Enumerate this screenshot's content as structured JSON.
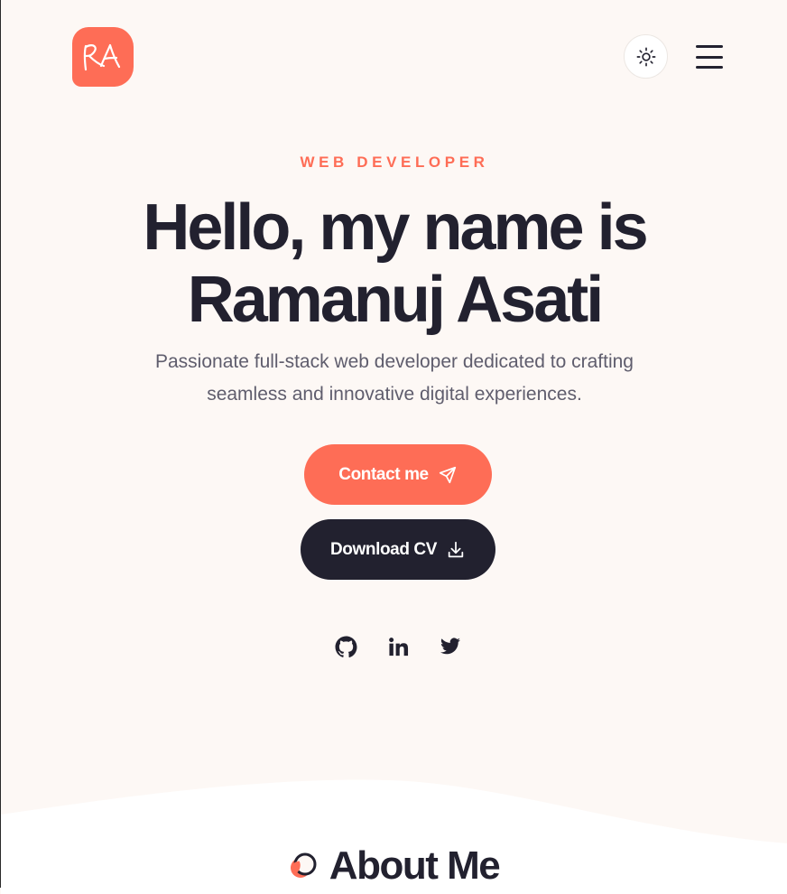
{
  "header": {
    "logo_text": "RA",
    "theme_icon": "sun-icon",
    "menu_icon": "hamburger-menu-icon"
  },
  "hero": {
    "eyebrow": "WEB DEVELOPER",
    "headline_line1": "Hello, my name is",
    "headline_line2": "Ramanuj Asati",
    "subtitle_line1": "Passionate full-stack web developer dedicated to crafting",
    "subtitle_line2": "seamless and innovative digital experiences.",
    "contact_label": "Contact me",
    "contact_icon": "send-icon",
    "cv_label": "Download CV",
    "cv_icon": "download-icon"
  },
  "socials": [
    {
      "icon": "github-icon"
    },
    {
      "icon": "linkedin-icon"
    },
    {
      "icon": "twitter-icon"
    }
  ],
  "about": {
    "title": "About Me",
    "icon": "about-dot-icon"
  },
  "colors": {
    "accent": "#fe6d56",
    "dark": "#22212f",
    "background": "#fdf8f5",
    "section_background": "#ffffff",
    "muted_text": "#5f5d6d"
  }
}
